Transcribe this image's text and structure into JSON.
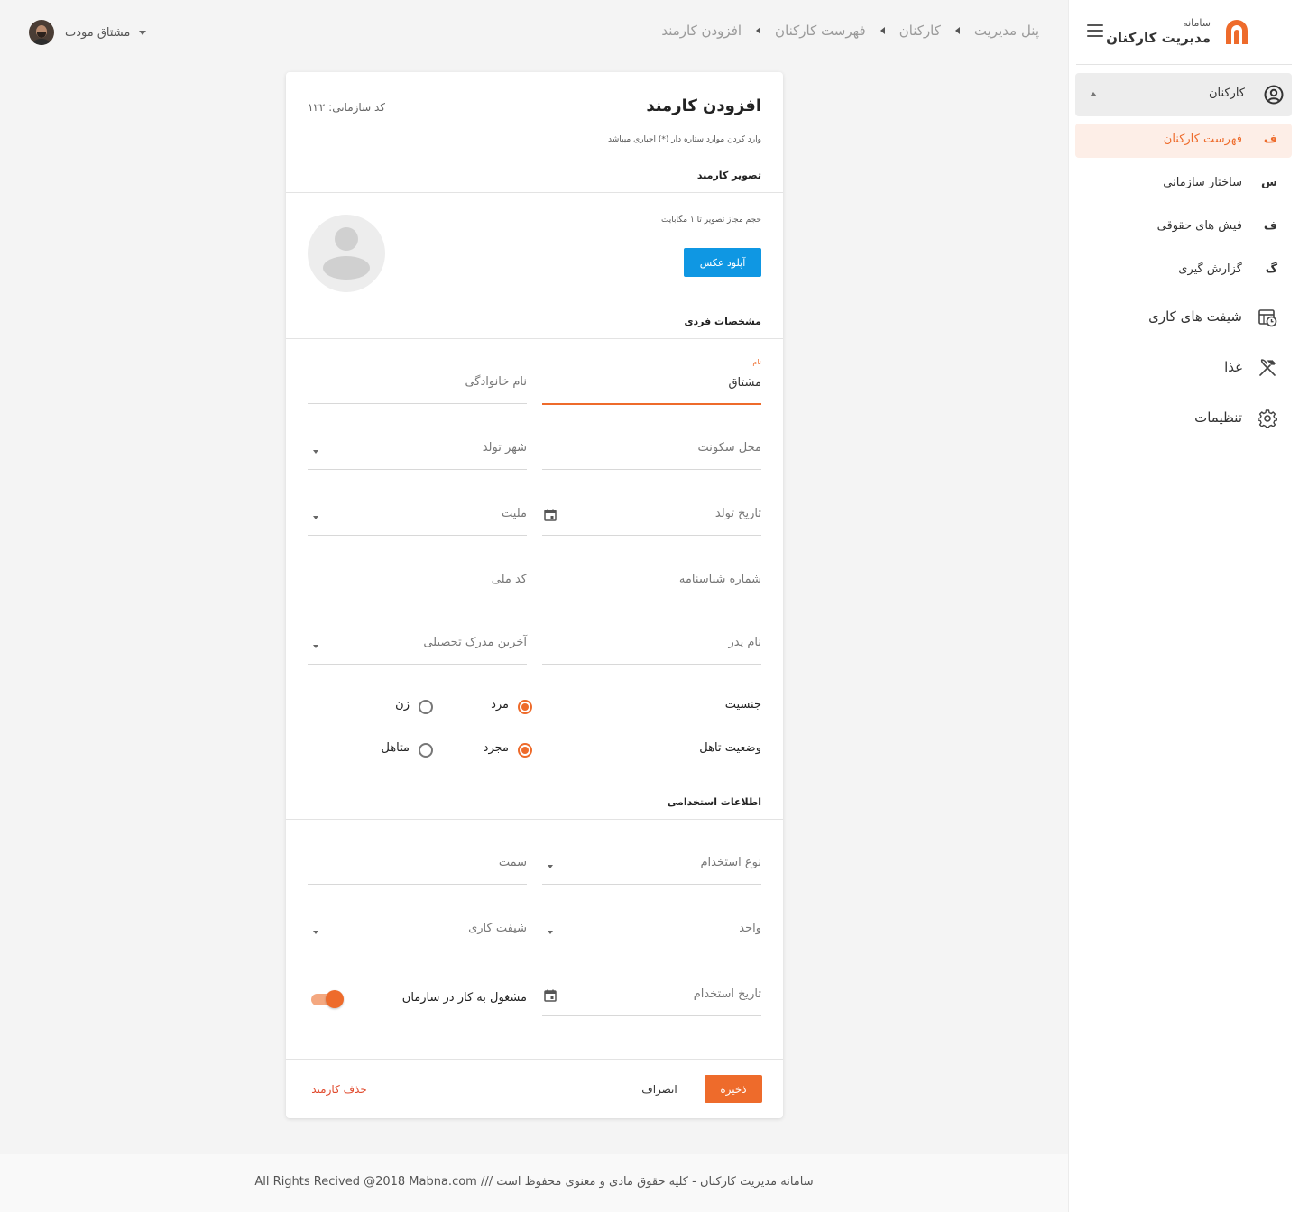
{
  "sidebar": {
    "brand_sub": "سامانه",
    "brand_title": "مدیریت کارکنان",
    "group_label": "کارکنان",
    "sub_items": [
      {
        "letter": "ف",
        "label": "فهرست کارکنان"
      },
      {
        "letter": "س",
        "label": "ساختار سازمانی"
      },
      {
        "letter": "ف",
        "label": "فیش های حقوقی"
      },
      {
        "letter": "گ",
        "label": "گزارش گیری"
      }
    ],
    "items": [
      {
        "label": "شیفت های کاری",
        "icon": "calendar-clock-icon"
      },
      {
        "label": "غذا",
        "icon": "utensils-icon"
      },
      {
        "label": "تنظیمات",
        "icon": "gear-icon"
      }
    ]
  },
  "breadcrumb": [
    "پنل مدیریت",
    "کارکنان",
    "فهرست کارکنان",
    "افزودن کارمند"
  ],
  "user": {
    "name": "مشتاق مودت"
  },
  "form": {
    "title": "افزودن کارمند",
    "org_code": "کد سازمانی: ۱۲۲",
    "hint": "وارد کردن موارد ستاره دار (*) اجباری میباشد",
    "photo_section": "تصویر کارمند",
    "size_hint": "حجم مجاز تصویر تا ۱ مگابایت",
    "upload_label": "آپلود عکس",
    "personal_section": "مشخصات فردی",
    "first_name_label": "نام",
    "first_name_value": "مشتاق",
    "last_name": "نام خانوادگی",
    "residence": "محل سکونت",
    "birth_city": "شهر تولد",
    "birth_date": "تاریخ تولد",
    "nationality": "ملیت",
    "id_number": "شماره شناسنامه",
    "national_code": "کد ملی",
    "father_name": "نام پدر",
    "education": "آخرین مدرک تحصیلی",
    "gender_label": "جنسیت",
    "gender_male": "مرد",
    "gender_female": "زن",
    "marital_label": "وضعیت تاهل",
    "marital_single": "مجرد",
    "marital_married": "متاهل",
    "employment_section": "اطلاعات استخدامی",
    "employment_type": "نوع استخدام",
    "position": "سمت",
    "unit": "واحد",
    "work_shift": "شیفت کاری",
    "hire_date": "تاریخ استخدام",
    "employed_label": "مشغول به کار در سازمان",
    "save": "ذخیره",
    "cancel": "انصراف",
    "delete": "حذف کارمند"
  },
  "footer": {
    "text": "سامانه مدیریت کارکنان - کلیه حقوق مادی و معنوی محفوظ است   ///   All Rights Recived @2018 Mabna.com"
  },
  "colors": {
    "accent": "#ee6b2b",
    "upload": "#0f97e3",
    "danger": "#e0492c"
  }
}
